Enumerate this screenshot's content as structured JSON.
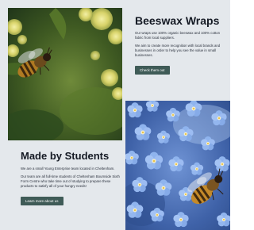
{
  "photos": {
    "bee_on_flower": "bee-on-yellow-flower-photo",
    "bee_on_forget_me_nots": "bee-on-blue-flowers-photo"
  },
  "colors": {
    "background": "#e4e8ec",
    "button": "#3f5b57",
    "heading": "#151a24"
  },
  "wraps": {
    "title": "Beeswax Wraps",
    "paragraphs": [
      "Our wraps use 100% organic beeswax and 100% cotton fabric from local suppliers.",
      "We aim to create more recognition with local brands and businesses in order to help you see the value in small businesses."
    ],
    "button_label": "Check them out"
  },
  "students": {
    "title": "Made by Students",
    "paragraphs": [
      "We are a small Young Enterprise team located in Cheltenham.",
      "Our team are all full-time students of Cheltenham Bournside Sixth Form Centre who take time out of studying to prepare these products to satisfy all of your hungry needs!"
    ],
    "button_label": "Learn more about us"
  }
}
